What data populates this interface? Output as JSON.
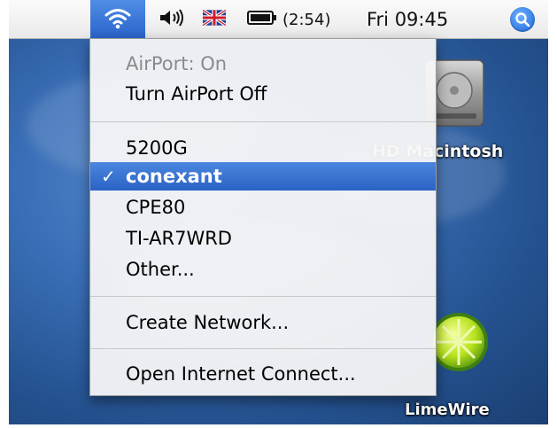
{
  "menubar": {
    "battery_time": "(2:54)",
    "clock": "Fri 09:45"
  },
  "icons": {
    "airport": "wifi-icon",
    "volume": "speaker-icon",
    "input_menu": "uk-flag-icon",
    "battery": "battery-icon",
    "spotlight": "magnifier-icon"
  },
  "desktop": {
    "hd_label": "HD Macintosh",
    "limewire_label": "LimeWire"
  },
  "menu": {
    "status": "AirPort: On",
    "turn_off": "Turn AirPort Off",
    "networks": [
      {
        "name": "5200G",
        "selected": false
      },
      {
        "name": "conexant",
        "selected": true
      },
      {
        "name": "CPE80",
        "selected": false
      },
      {
        "name": "TI-AR7WRD",
        "selected": false
      }
    ],
    "other": "Other...",
    "create_network": "Create Network...",
    "open_internet_connect": "Open Internet Connect...",
    "checkmark": "✓"
  },
  "colors": {
    "selection": "#3570d2",
    "menubar_highlight": "#2f6cd3"
  }
}
